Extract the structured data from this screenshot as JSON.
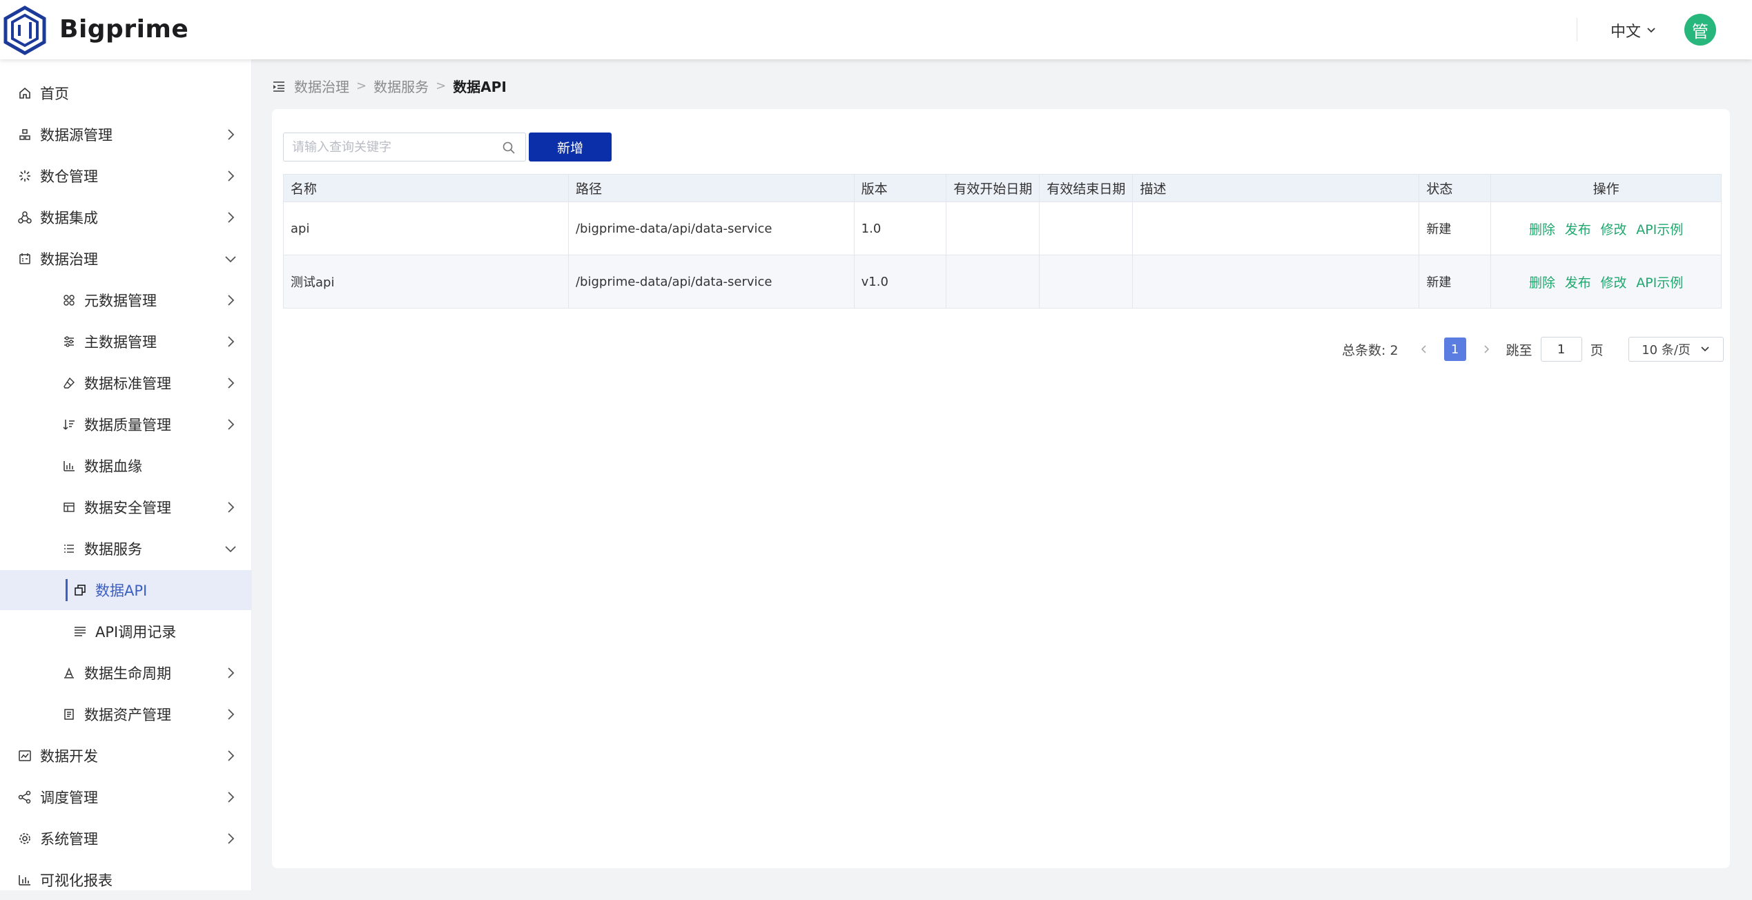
{
  "header": {
    "brand": "Bigprime",
    "language": "中文",
    "avatar_text": "管"
  },
  "sidebar": {
    "items": [
      {
        "label": "首页",
        "icon": "home-icon"
      },
      {
        "label": "数据源管理",
        "icon": "datasource-icon"
      },
      {
        "label": "数仓管理",
        "icon": "warehouse-icon"
      },
      {
        "label": "数据集成",
        "icon": "integration-icon"
      },
      {
        "label": "数据治理",
        "icon": "governance-icon",
        "expanded": true
      },
      {
        "label": "元数据管理",
        "icon": "metadata-icon"
      },
      {
        "label": "主数据管理",
        "icon": "sliders-icon"
      },
      {
        "label": "数据标准管理",
        "icon": "eraser-icon"
      },
      {
        "label": "数据质量管理",
        "icon": "quality-icon"
      },
      {
        "label": "数据血缘",
        "icon": "bar-chart-icon"
      },
      {
        "label": "数据安全管理",
        "icon": "security-table-icon"
      },
      {
        "label": "数据服务",
        "icon": "list-icon",
        "expanded": true
      },
      {
        "label": "数据API",
        "icon": "api-window-icon",
        "active": true
      },
      {
        "label": "API调用记录",
        "icon": "lines-icon"
      },
      {
        "label": "数据生命周期",
        "icon": "lifecycle-icon"
      },
      {
        "label": "数据资产管理",
        "icon": "asset-icon"
      },
      {
        "label": "数据开发",
        "icon": "develop-icon"
      },
      {
        "label": "调度管理",
        "icon": "share-icon"
      },
      {
        "label": "系统管理",
        "icon": "gear-icon"
      },
      {
        "label": "可视化报表",
        "icon": "report-icon"
      }
    ]
  },
  "breadcrumb": [
    "数据治理",
    "数据服务",
    "数据API"
  ],
  "toolbar": {
    "search_placeholder": "请输入查询关键字",
    "add_label": "新增"
  },
  "table": {
    "columns": [
      "名称",
      "路径",
      "版本",
      "有效开始日期",
      "有效结束日期",
      "描述",
      "状态",
      "操作"
    ],
    "rows": [
      {
        "name": "api",
        "path": "/bigprime-data/api/data-service",
        "version": "1.0",
        "start": "",
        "end": "",
        "desc": "",
        "status": "新建"
      },
      {
        "name": "测试api",
        "path": "/bigprime-data/api/data-service",
        "version": "v1.0",
        "start": "",
        "end": "",
        "desc": "",
        "status": "新建"
      }
    ],
    "actions": [
      "删除",
      "发布",
      "修改",
      "API示例"
    ]
  },
  "pagination": {
    "total_label": "总条数:",
    "total": "2",
    "current_page": "1",
    "jump_label": "跳至",
    "jump_value": "1",
    "page_unit": "页",
    "page_size": "10 条/页"
  },
  "colors": {
    "primary": "#0b2fa8",
    "active_nav": "#3c5fc4",
    "action_link": "#1fa86e",
    "avatar": "#27b67c",
    "page_active": "#5b7ce0"
  }
}
